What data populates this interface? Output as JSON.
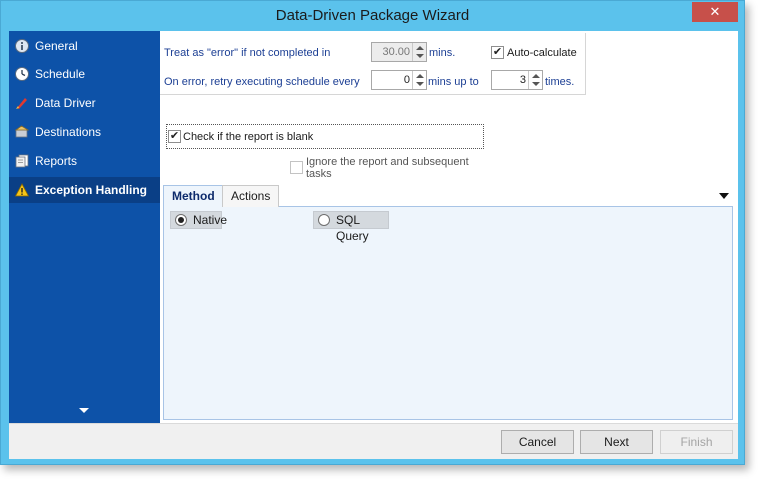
{
  "window": {
    "title": "Data-Driven Package Wizard",
    "close_glyph": "✕"
  },
  "sidebar": {
    "items": [
      {
        "label": "General",
        "icon": "info-icon"
      },
      {
        "label": "Schedule",
        "icon": "clock-icon"
      },
      {
        "label": "Data Driver",
        "icon": "data-driver-icon"
      },
      {
        "label": "Destinations",
        "icon": "destinations-icon"
      },
      {
        "label": "Reports",
        "icon": "reports-icon"
      },
      {
        "label": "Exception Handling",
        "icon": "warning-icon",
        "active": true
      }
    ]
  },
  "exceptions": {
    "error_label": "Treat as \"error\" if not completed in",
    "error_minutes": "30.00",
    "error_unit": "mins.",
    "auto_calculate_label": "Auto-calculate",
    "auto_calculate_checked": true,
    "retry_label": "On error, retry  executing schedule every",
    "retry_minutes": "0",
    "retry_unit": "mins up to",
    "retry_times": "3",
    "retry_times_unit": "times."
  },
  "blank_check": {
    "label": "Check if the report is blank",
    "checked": true,
    "ignore_label": "Ignore the report and subsequent tasks",
    "ignore_checked": false
  },
  "tabs": [
    {
      "label": "Method",
      "active": true
    },
    {
      "label": "Actions",
      "active": false
    }
  ],
  "method": {
    "options": [
      {
        "label": "Native",
        "selected": true
      },
      {
        "label": "SQL Query",
        "selected": false
      }
    ]
  },
  "footer": {
    "cancel_label": "Cancel",
    "next_label": "Next",
    "finish_label": "Finish"
  },
  "colors": {
    "frame": "#5bc2ec",
    "sidebar": "#0d52a8",
    "sidebar_active": "#0a3f86",
    "close_button": "#c7504a",
    "label_blue": "#1c3f94"
  }
}
